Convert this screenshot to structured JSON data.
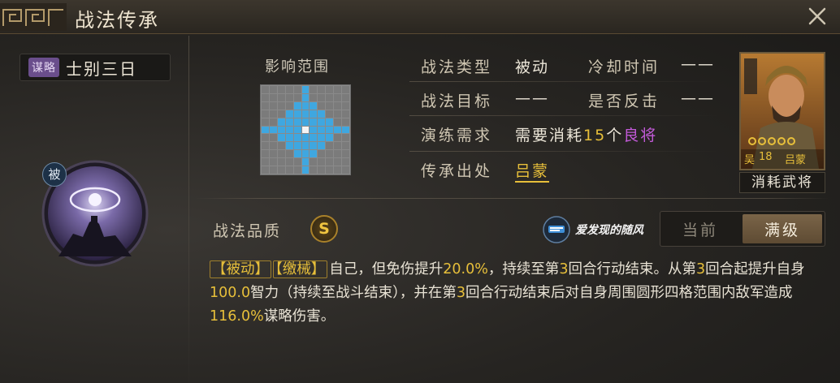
{
  "title": "战法传承",
  "skill": {
    "type_badge": "谋略",
    "name": "士别三日",
    "icon_badge": "被"
  },
  "range": {
    "label": "影响范围"
  },
  "info": {
    "type_label": "战法类型",
    "type_value": "被动",
    "cooldown_label": "冷却时间",
    "cooldown_value": "——",
    "target_label": "战法目标",
    "target_value": "——",
    "counter_label": "是否反击",
    "counter_value": "——",
    "train_label": "演练需求",
    "train_prefix": "需要消耗",
    "train_count": "15",
    "train_unit": "个",
    "train_item": "良将",
    "source_label": "传承出处",
    "source_value": "吕蒙"
  },
  "general": {
    "faction": "吴",
    "level": "18",
    "name": "吕蒙",
    "caption": "消耗武将"
  },
  "quality": {
    "label": "战法品质",
    "grade": "S"
  },
  "watermark": "爱发现的随风",
  "toggle": {
    "current": "当前",
    "max": "满级",
    "selected": "满级"
  },
  "description": {
    "tag1": "【被动】",
    "tag2": "【缴械】",
    "seg1": "自己，但免伤提升",
    "val1": "20.0%",
    "seg2": "，持续至第",
    "val2": "3",
    "seg3": "回合行动结束。从第",
    "val3": "3",
    "seg4": "回合起提升自身",
    "val4": "100.0",
    "seg5": "智力（持续至战斗结束），并在第",
    "val5": "3",
    "seg6": "回合行动结束后对自身周围圆形四格范围内敌军造成",
    "val6": "116.0%",
    "seg7": "谋略伤害。"
  },
  "colors": {
    "gold": "#e7bf3a",
    "purple": "#c25ad8",
    "range_on": "#3fa7e0",
    "badge_purple": "#6a4e8c"
  }
}
